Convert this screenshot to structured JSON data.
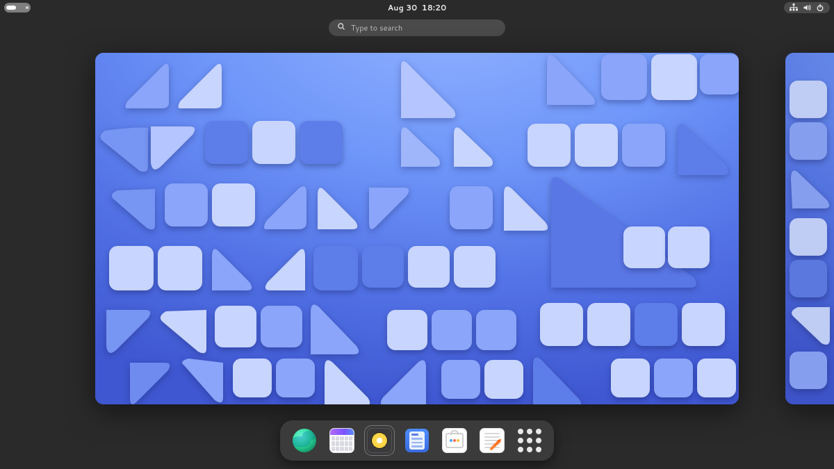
{
  "topbar": {
    "date": "Aug 30",
    "time": "18:20"
  },
  "search": {
    "placeholder": "Type to search"
  }
}
